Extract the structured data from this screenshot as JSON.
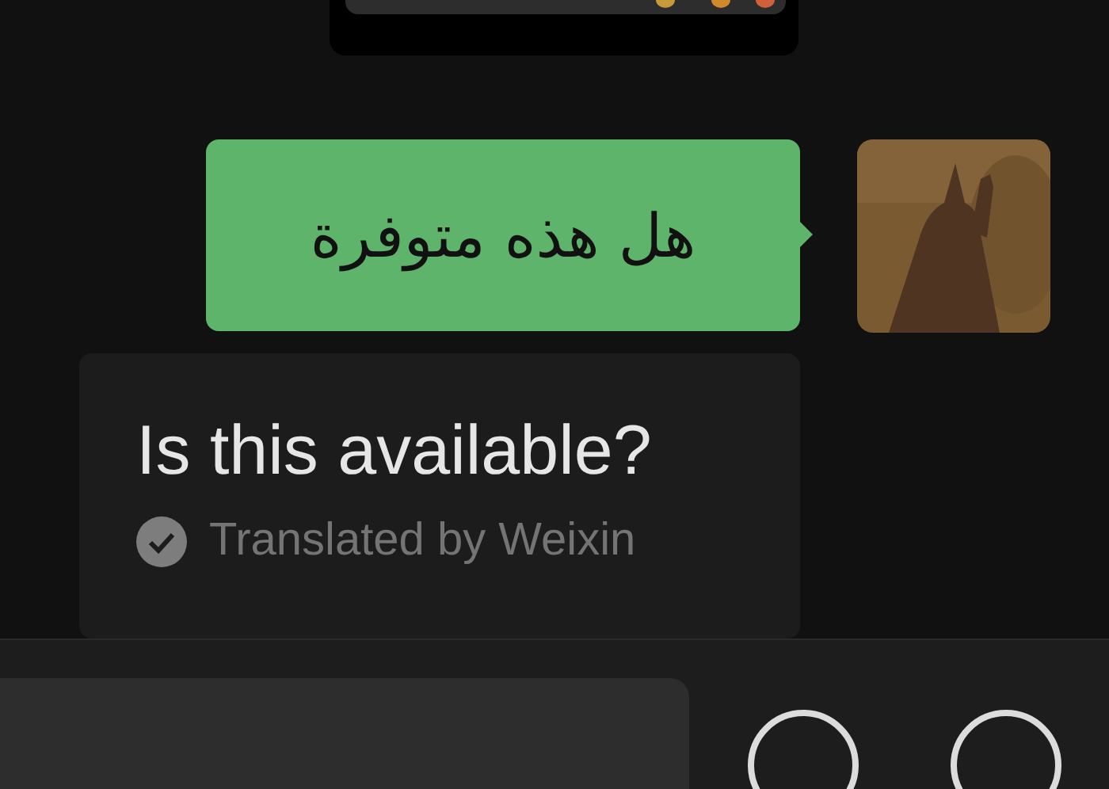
{
  "message": {
    "text": "هل هذه متوفرة"
  },
  "translation": {
    "text": "Is this available?",
    "note": "Translated by Weixin"
  }
}
